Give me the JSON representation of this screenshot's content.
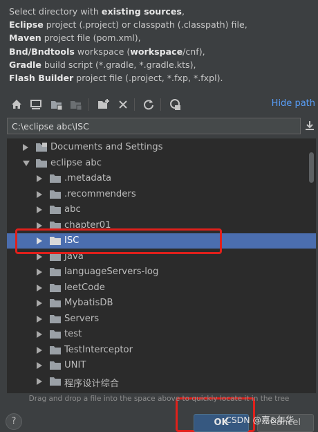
{
  "description": {
    "line1_prefix": "Select directory with ",
    "line1_bold": "existing sources",
    "line1_suffix": ",",
    "line2_bold": "Eclipse",
    "line2_rest": " project (.project) or classpath (.classpath) file,",
    "line3_bold": "Maven",
    "line3_rest": " project file (pom.xml),",
    "line4_bold": "Bnd/Bndtools",
    "line4_mid": " workspace (",
    "line4_bold2": "workspace",
    "line4_rest": "/cnf),",
    "line5_bold": "Gradle",
    "line5_rest": " build script (*.gradle, *.gradle.kts),",
    "line6_bold": "Flash Builder",
    "line6_rest": " project file (.project, *.fxp, *.fxpl)."
  },
  "toolbar": {
    "icons": [
      "home-icon",
      "desktop-icon",
      "project-folder-icon",
      "module-folder-icon",
      "new-folder-icon",
      "delete-icon",
      "refresh-icon",
      "show-hidden-icon"
    ],
    "hide_path_label": "Hide path"
  },
  "path_field": {
    "value": "C:\\eclipse abc\\ISC"
  },
  "tree": {
    "rows": [
      {
        "label": "Documents and Settings",
        "level": 0,
        "expanded": false,
        "selected": false
      },
      {
        "label": "eclipse abc",
        "level": 0,
        "expanded": true,
        "selected": false
      },
      {
        "label": ".metadata",
        "level": 1,
        "expanded": false,
        "selected": false
      },
      {
        "label": ".recommenders",
        "level": 1,
        "expanded": false,
        "selected": false
      },
      {
        "label": "abc",
        "level": 1,
        "expanded": false,
        "selected": false
      },
      {
        "label": "chapter01",
        "level": 1,
        "expanded": false,
        "selected": false
      },
      {
        "label": "ISC",
        "level": 1,
        "expanded": false,
        "selected": true
      },
      {
        "label": "Java",
        "level": 1,
        "expanded": false,
        "selected": false
      },
      {
        "label": "languageServers-log",
        "level": 1,
        "expanded": false,
        "selected": false
      },
      {
        "label": "leetCode",
        "level": 1,
        "expanded": false,
        "selected": false
      },
      {
        "label": "MybatisDB",
        "level": 1,
        "expanded": false,
        "selected": false
      },
      {
        "label": "Servers",
        "level": 1,
        "expanded": false,
        "selected": false
      },
      {
        "label": "test",
        "level": 1,
        "expanded": false,
        "selected": false
      },
      {
        "label": "TestInterceptor",
        "level": 1,
        "expanded": false,
        "selected": false
      },
      {
        "label": "UNIT",
        "level": 1,
        "expanded": false,
        "selected": false
      },
      {
        "label": "程序设计综合",
        "level": 1,
        "expanded": false,
        "selected": false
      }
    ]
  },
  "hint": "Drag and drop a file into the space above to quickly locate it in the tree",
  "buttons": {
    "help": "?",
    "ok": "OK",
    "cancel": "Cancel"
  },
  "watermark": "CSDN @嘉&年华",
  "colors": {
    "background": "#3c3f41",
    "tree_background": "#2b2b2b",
    "selection": "#4b6eaf",
    "link": "#589df6",
    "annotation_red": "#e0201b"
  }
}
